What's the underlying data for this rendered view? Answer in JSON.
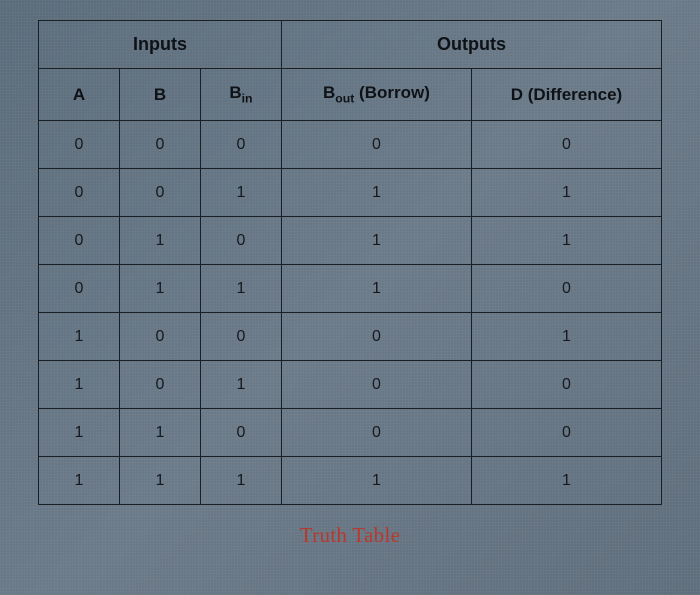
{
  "headers": {
    "inputs_group": "Inputs",
    "outputs_group": "Outputs",
    "A": "A",
    "B": "B",
    "Bin_prefix": "B",
    "Bin_sub": "in",
    "Bout_prefix": "B",
    "Bout_sub": "out",
    "Bout_suffix": " (Borrow)",
    "D": "D (Difference)"
  },
  "rows": [
    {
      "A": "0",
      "B": "0",
      "Bin": "0",
      "Bout": "0",
      "D": "0"
    },
    {
      "A": "0",
      "B": "0",
      "Bin": "1",
      "Bout": "1",
      "D": "1"
    },
    {
      "A": "0",
      "B": "1",
      "Bin": "0",
      "Bout": "1",
      "D": "1"
    },
    {
      "A": "0",
      "B": "1",
      "Bin": "1",
      "Bout": "1",
      "D": "0"
    },
    {
      "A": "1",
      "B": "0",
      "Bin": "0",
      "Bout": "0",
      "D": "1"
    },
    {
      "A": "1",
      "B": "0",
      "Bin": "1",
      "Bout": "0",
      "D": "0"
    },
    {
      "A": "1",
      "B": "1",
      "Bin": "0",
      "Bout": "0",
      "D": "0"
    },
    {
      "A": "1",
      "B": "1",
      "Bin": "1",
      "Bout": "1",
      "D": "1"
    }
  ],
  "caption": "Truth Table"
}
